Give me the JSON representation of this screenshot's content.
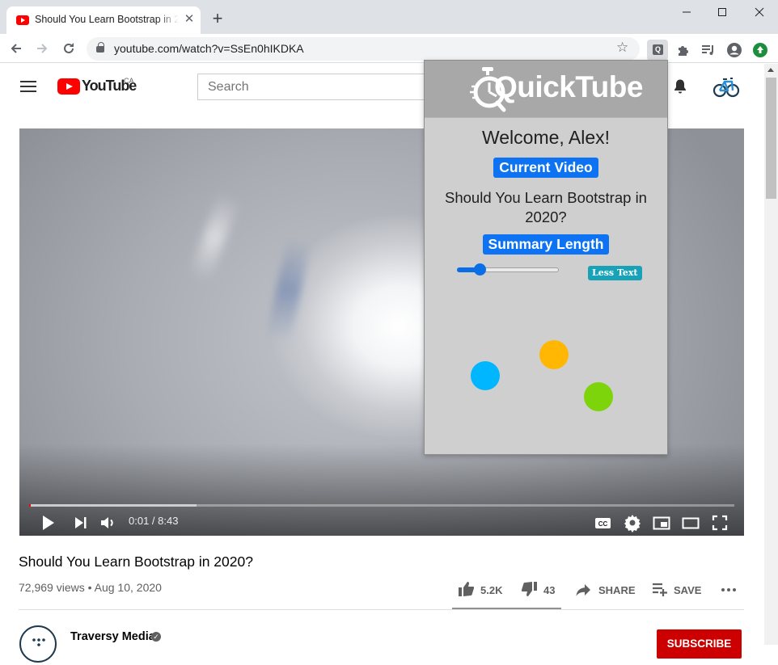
{
  "browser": {
    "tab_title": "Should You Learn Bootstrap in 2020?",
    "tab_close": "✕",
    "new_tab": "+",
    "url": "youtube.com/watch?v=SsEn0hIKDKA",
    "ext_letter": "Q"
  },
  "youtube": {
    "logo": "YouTube",
    "country": "CA",
    "search_placeholder": "Search",
    "video": {
      "progress_fraction": 0.002,
      "time": "0:01 / 8:43",
      "title": "Should You Learn Bootstrap in 2020?",
      "meta": "72,969 views • Aug 10, 2020"
    },
    "actions": {
      "likes": "5.2K",
      "dislikes": "43",
      "share": "SHARE",
      "save": "SAVE"
    },
    "channel": {
      "name": "Traversy Media",
      "verified": "✓",
      "subscribe": "SUBSCRIBE"
    }
  },
  "popup": {
    "logo": "QuickTube",
    "welcome": "Welcome, Alex!",
    "current_video_label": "Current Video",
    "current_video_title": "Should You Learn Bootstrap in 2020?",
    "summary_length_label": "Summary Length",
    "slider_fraction": 0.22,
    "less_text": "Less Text",
    "loader_colors": [
      "#00b6ff",
      "#ffb703",
      "#7ed40b"
    ]
  }
}
